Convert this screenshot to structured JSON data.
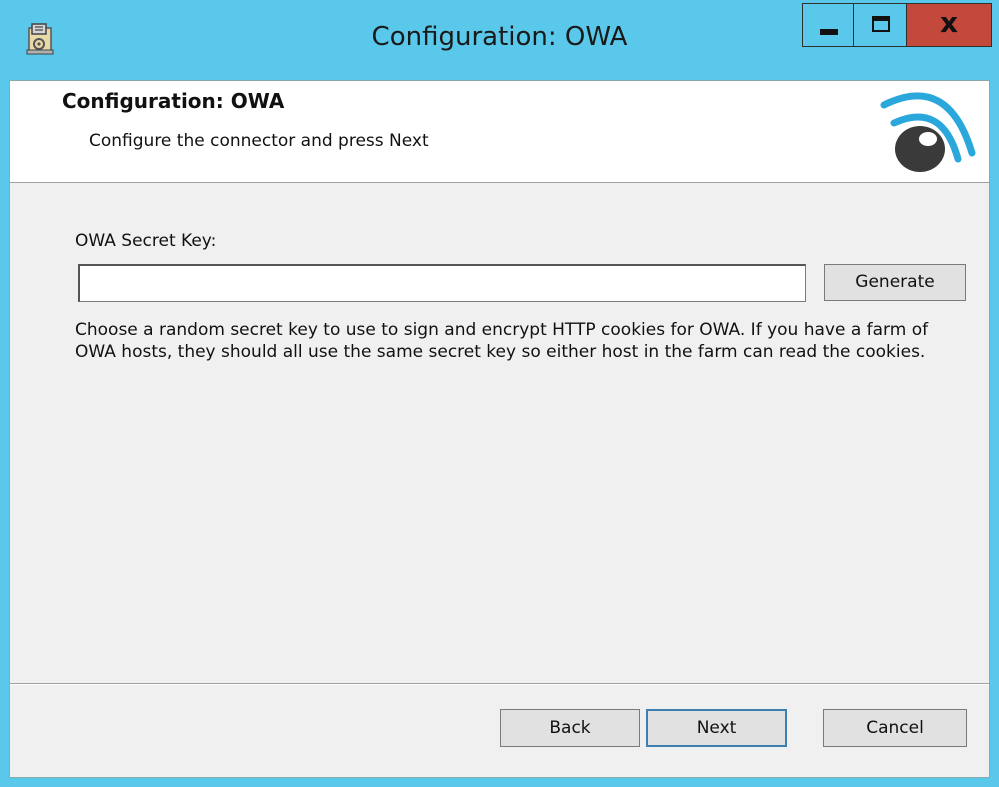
{
  "window": {
    "title": "Configuration: OWA",
    "app_icon": "installer-package-icon",
    "controls": {
      "minimize_icon": "minimize-icon",
      "maximize_icon": "maximize-icon",
      "close_label": "x"
    },
    "colors": {
      "frame": "#5ac8ea",
      "close_button": "#c4493d",
      "client_background": "#f0f0f0",
      "banner_background": "#ffffff"
    }
  },
  "banner": {
    "title": "Configuration: OWA",
    "subtitle": "Configure the connector and press Next",
    "logo": "signal-logo-icon"
  },
  "form": {
    "secret_key_label": "OWA Secret Key:",
    "secret_key_value": "",
    "generate_label": "Generate",
    "description": "Choose a random secret key to use to sign and encrypt HTTP cookies for OWA. If you have a farm of OWA hosts, they should all use the same secret key so either host in the farm can read the cookies."
  },
  "footer": {
    "back_label": "Back",
    "next_label": "Next",
    "cancel_label": "Cancel"
  }
}
